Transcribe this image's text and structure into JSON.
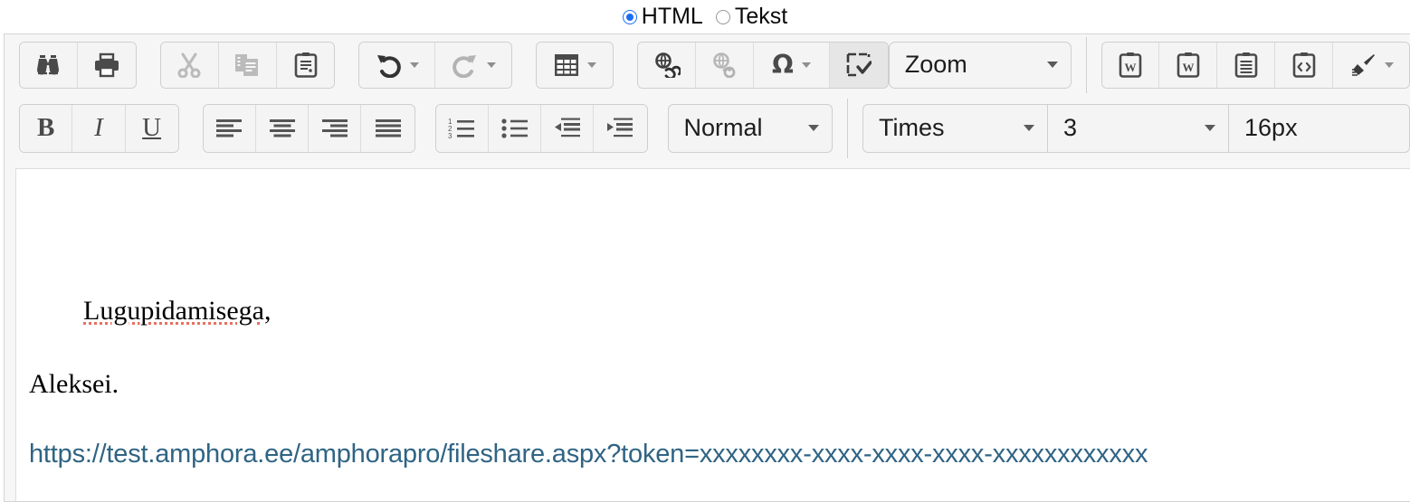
{
  "mode_selector": {
    "options": [
      {
        "label": "HTML",
        "selected": true
      },
      {
        "label": "Tekst",
        "selected": false
      }
    ]
  },
  "toolbar": {
    "row1": {
      "group_document": [
        {
          "name": "preview-button",
          "icon": "binoculars-icon",
          "label": "Preview",
          "enabled": true
        },
        {
          "name": "print-button",
          "icon": "printer-icon",
          "label": "Print",
          "enabled": true
        }
      ],
      "group_clipboard": [
        {
          "name": "cut-button",
          "icon": "scissors-icon",
          "label": "Cut",
          "enabled": false
        },
        {
          "name": "copy-button",
          "icon": "copy-icon",
          "label": "Copy",
          "enabled": false
        },
        {
          "name": "paste-button",
          "icon": "clipboard-icon",
          "label": "Paste",
          "enabled": true
        }
      ],
      "group_history": [
        {
          "name": "undo-button",
          "icon": "undo-arrow-icon",
          "label": "Undo",
          "enabled": true,
          "has_dropdown": true
        },
        {
          "name": "redo-button",
          "icon": "redo-arrow-icon",
          "label": "Redo",
          "enabled": false,
          "has_dropdown": true
        }
      ],
      "group_table": [
        {
          "name": "table-button",
          "icon": "table-grid-icon",
          "label": "Table",
          "enabled": true,
          "has_dropdown": true
        }
      ],
      "group_insert": [
        {
          "name": "insert-link-button",
          "icon": "link-globe-icon",
          "label": "Insert link",
          "enabled": true
        },
        {
          "name": "remove-link-button",
          "icon": "unlink-globe-icon",
          "label": "Remove link",
          "enabled": false
        },
        {
          "name": "special-character-button",
          "icon": "omega-icon",
          "glyph": "Ω",
          "label": "Special character",
          "enabled": true,
          "has_dropdown": true
        },
        {
          "name": "select-all-button",
          "icon": "select-all-check-icon",
          "label": "Select all",
          "enabled": true,
          "active": true
        }
      ],
      "zoom_select": {
        "name": "zoom-select",
        "value": "Zoom"
      },
      "group_paste": [
        {
          "name": "paste-from-word-button",
          "icon": "clipboard-word-icon",
          "label": "Paste from Word",
          "enabled": true
        },
        {
          "name": "paste-from-word-clean-button",
          "icon": "clipboard-word-icon",
          "label": "Paste from Word (clean)",
          "enabled": true
        },
        {
          "name": "paste-as-plain-text-button",
          "icon": "clipboard-lines-icon",
          "label": "Paste as plain text",
          "enabled": true
        },
        {
          "name": "paste-as-html-button",
          "icon": "clipboard-code-icon",
          "label": "Paste as HTML",
          "enabled": true
        },
        {
          "name": "format-painter-button",
          "icon": "paint-brush-icon",
          "label": "Format painter",
          "enabled": true,
          "has_dropdown": true
        }
      ]
    },
    "row2": {
      "group_style": [
        {
          "name": "bold-button",
          "icon": "bold-icon",
          "glyph": "B",
          "label": "Bold"
        },
        {
          "name": "italic-button",
          "icon": "italic-icon",
          "glyph": "I",
          "label": "Italic"
        },
        {
          "name": "underline-button",
          "icon": "underline-icon",
          "glyph": "U",
          "label": "Underline"
        }
      ],
      "group_align": [
        {
          "name": "align-left-button",
          "icon": "align-left-icon",
          "label": "Align left"
        },
        {
          "name": "align-center-button",
          "icon": "align-center-icon",
          "label": "Align center"
        },
        {
          "name": "align-right-button",
          "icon": "align-right-icon",
          "label": "Align right"
        },
        {
          "name": "align-justify-button",
          "icon": "align-justify-icon",
          "label": "Justify"
        }
      ],
      "group_list": [
        {
          "name": "numbered-list-button",
          "icon": "numbered-list-icon",
          "label": "Numbered list"
        },
        {
          "name": "bulleted-list-button",
          "icon": "bulleted-list-icon",
          "label": "Bulleted list"
        },
        {
          "name": "decrease-indent-button",
          "icon": "decrease-indent-icon",
          "label": "Decrease indent"
        },
        {
          "name": "increase-indent-button",
          "icon": "increase-indent-icon",
          "label": "Increase indent"
        }
      ],
      "paragraph_format_select": {
        "name": "paragraph-format-select",
        "value": "Normal"
      },
      "font_family_select": {
        "name": "font-family-select",
        "value": "Times"
      },
      "font_size_select": {
        "name": "font-size-select",
        "value": "3"
      },
      "pixel_size_field": {
        "name": "pixel-size-field",
        "value": "16px"
      }
    }
  },
  "content": {
    "signature_line_1": "Lugupidamisega,",
    "signature_line_2": "Aleksei.",
    "link": "https://test.amphora.ee/amphorapro/fileshare.aspx?token=xxxxxxxx-xxxx-xxxx-xxxx-xxxxxxxxxxxx",
    "link_color": "#2f6484",
    "spellcheck_underline_color": "#e8705f"
  }
}
